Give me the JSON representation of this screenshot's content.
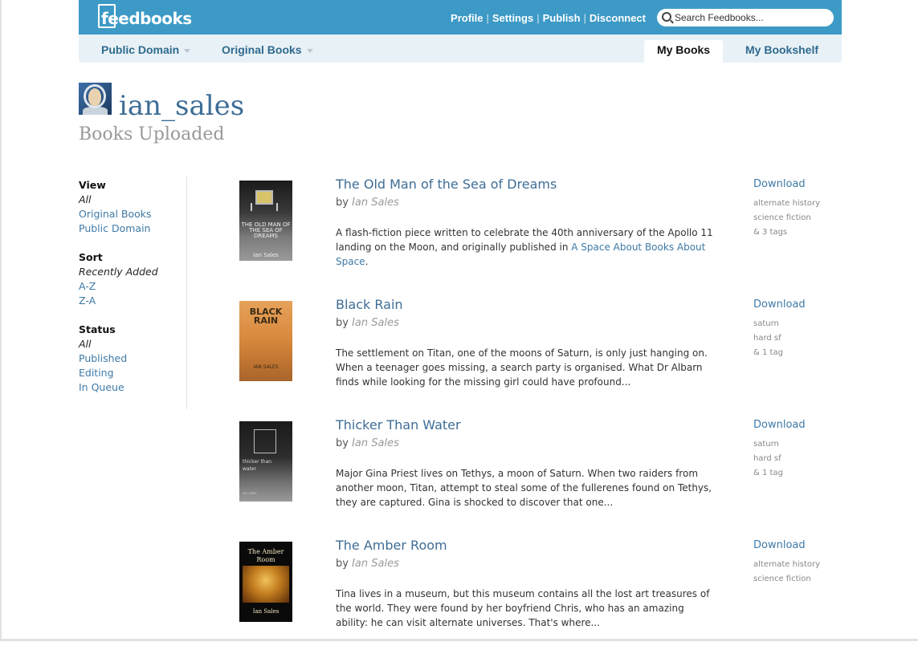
{
  "header": {
    "logo_text": "feedbooks",
    "links": [
      "Profile",
      "Settings",
      "Publish",
      "Disconnect"
    ],
    "search_placeholder": "Search Feedbooks..."
  },
  "nav": {
    "public_domain": "Public Domain",
    "original_books": "Original Books",
    "my_books": "My Books",
    "my_bookshelf": "My Bookshelf"
  },
  "profile": {
    "username": "ian_sales",
    "page_title": "Books Uploaded"
  },
  "sidebar": {
    "view": {
      "heading": "View",
      "items": [
        "All",
        "Original Books",
        "Public Domain"
      ],
      "current": "All"
    },
    "sort": {
      "heading": "Sort",
      "items": [
        "Recently Added",
        "A-Z",
        "Z-A"
      ],
      "current": "Recently Added"
    },
    "status": {
      "heading": "Status",
      "items": [
        "All",
        "Published",
        "Editing",
        "In Queue"
      ],
      "current": "All"
    }
  },
  "books": [
    {
      "title": "The Old Man of the Sea of Dreams",
      "by": "by",
      "author": "Ian Sales",
      "desc_before": "A flash-fiction piece written to celebrate the 40th anniversary of the Apollo 11 landing on the Moon, and originally published in ",
      "desc_link": "A Space About Books About Space",
      "desc_after": ".",
      "download": "Download",
      "tags": [
        "alternate history",
        "science fiction",
        "& 3 tags"
      ],
      "cover": {
        "title": "THE OLD MAN OF THE SEA OF DREAMS",
        "author": "Ian Sales"
      }
    },
    {
      "title": "Black Rain",
      "by": "by",
      "author": "Ian Sales",
      "desc_before": "The settlement on Titan, one of the moons of Saturn, is only just hanging on. When a teenager goes missing, a search party is organised. What Dr Albarn finds while looking for the missing girl could have profound...",
      "desc_link": "",
      "desc_after": "",
      "download": "Download",
      "tags": [
        "saturn",
        "hard sf",
        "& 1 tag"
      ],
      "cover": {
        "title": "BLACK RAIN",
        "author": "IAN SALES"
      }
    },
    {
      "title": "Thicker Than Water",
      "by": "by",
      "author": "Ian Sales",
      "desc_before": "Major Gina Priest lives on Tethys, a moon of Saturn. When two raiders from another moon, Titan, attempt to steal some of the fullerenes found on Tethys, they are captured. Gina is shocked to discover that one...",
      "desc_link": "",
      "desc_after": "",
      "download": "Download",
      "tags": [
        "saturn",
        "hard sf",
        "& 1 tag"
      ],
      "cover": {
        "title": "thicker than water",
        "author": "ian sales"
      }
    },
    {
      "title": "The Amber Room",
      "by": "by",
      "author": "Ian Sales",
      "desc_before": "Tina lives in a museum, but this museum contains all the lost art treasures of the world. They were found by her boyfriend Chris, who has an amazing ability: he can visit alternate universes. That's where...",
      "desc_link": "",
      "desc_after": "",
      "download": "Download",
      "tags": [
        "alternate history",
        "science fiction"
      ],
      "cover": {
        "title": "The Amber Room",
        "author": "Ian Sales"
      }
    }
  ]
}
